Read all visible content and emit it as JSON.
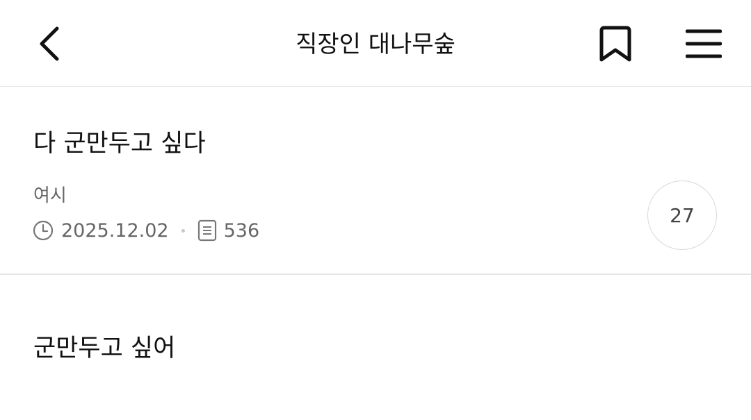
{
  "header": {
    "title": "직장인 대나무숲",
    "back_icon": "chevron-left-icon",
    "bookmark_icon": "bookmark-icon",
    "menu_icon": "hamburger-menu-icon"
  },
  "posts": [
    {
      "title": "다 군만두고 싶다",
      "author": "여시",
      "date": "2025.12.02",
      "views": "536",
      "comments": "27"
    },
    {
      "title": "군만두고 싶어"
    }
  ],
  "colors": {
    "text": "#111111",
    "meta_text": "#666666",
    "divider": "#e6e6e6"
  }
}
